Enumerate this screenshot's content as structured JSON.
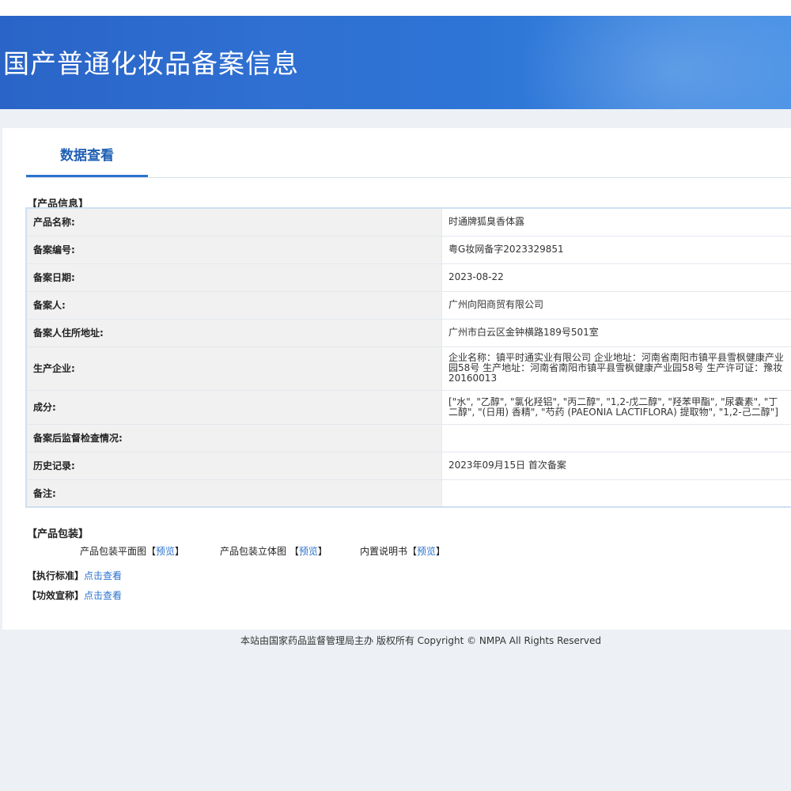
{
  "banner": {
    "title": "国产普通化妆品备案信息"
  },
  "tab": {
    "label": "数据查看"
  },
  "product_info": {
    "heading": "【产品信息】",
    "rows": [
      {
        "label": "产品名称:",
        "value": "时通牌狐臭香体露"
      },
      {
        "label": "备案编号:",
        "value": "粤G妆网备字2023329851"
      },
      {
        "label": "备案日期:",
        "value": "2023-08-22"
      },
      {
        "label": "备案人:",
        "value": "广州向阳商贸有限公司"
      },
      {
        "label": "备案人住所地址:",
        "value": "广州市白云区金钟横路189号501室"
      },
      {
        "label": "生产企业:",
        "value": "企业名称：镇平时通实业有限公司 企业地址：河南省南阳市镇平县雪枫健康产业园58号 生产地址：河南省南阳市镇平县雪枫健康产业园58号 生产许可证：豫妆20160013"
      },
      {
        "label": "成分:",
        "value": "[\"水\", \"乙醇\", \"氯化羟铝\", \"丙二醇\", \"1,2-戊二醇\", \"羟苯甲酯\", \"尿囊素\", \"丁二醇\", \"(日用) 香精\", \"芍药 (PAEONIA LACTIFLORA) 提取物\", \"1,2-己二醇\"]"
      },
      {
        "label": "备案后监督检查情况:",
        "value": ""
      },
      {
        "label": "历史记录:",
        "value": "2023年09月15日 首次备案"
      },
      {
        "label": "备注:",
        "value": ""
      }
    ]
  },
  "packaging": {
    "heading": "【产品包装】",
    "items": [
      {
        "label": "产品包装平面图",
        "open": "【",
        "link": "预览",
        "close": "】"
      },
      {
        "label": "产品包装立体图 ",
        "open": "【",
        "link": "预览",
        "close": "】"
      },
      {
        "label": "内置说明书",
        "open": "【",
        "link": "预览",
        "close": "】"
      }
    ]
  },
  "standard": {
    "heading": "【执行标准】",
    "link": "点击查看"
  },
  "efficacy": {
    "heading": "【功效宣称】",
    "link": "点击查看"
  },
  "footer": {
    "text": "本站由国家药品监督管理局主办 版权所有 Copyright © NMPA All Rights Reserved"
  },
  "colors": {
    "banner": "#2d6fd2",
    "link": "#2b73cf",
    "tab_text": "#1f5fb4"
  }
}
